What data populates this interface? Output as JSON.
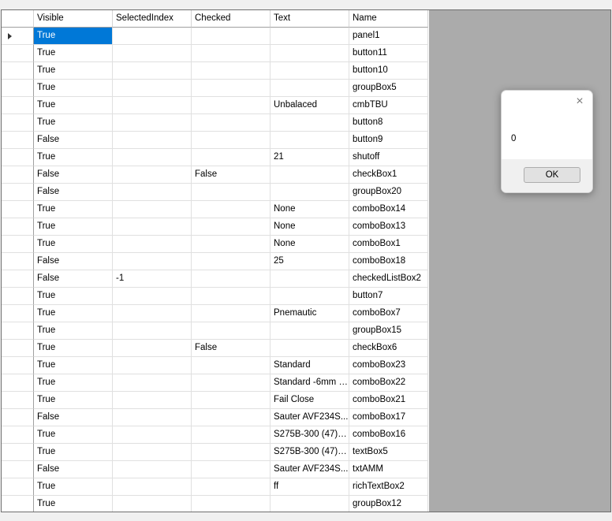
{
  "grid": {
    "columns": [
      "Visible",
      "SelectedIndex",
      "Checked",
      "Text",
      "Name"
    ],
    "rows": [
      [
        "True",
        "",
        "",
        "",
        "panel1"
      ],
      [
        "True",
        "",
        "",
        "",
        "button11"
      ],
      [
        "True",
        "",
        "",
        "",
        "button10"
      ],
      [
        "True",
        "",
        "",
        "",
        "groupBox5"
      ],
      [
        "True",
        "",
        "",
        "Unbalaced",
        "cmbTBU"
      ],
      [
        "True",
        "",
        "",
        "",
        "button8"
      ],
      [
        "False",
        "",
        "",
        "",
        "button9"
      ],
      [
        "True",
        "",
        "",
        "21",
        "shutoff"
      ],
      [
        "False",
        "",
        "False",
        "",
        "checkBox1"
      ],
      [
        "False",
        "",
        "",
        "",
        "groupBox20"
      ],
      [
        "True",
        "",
        "",
        "None",
        "comboBox14"
      ],
      [
        "True",
        "",
        "",
        "None",
        "comboBox13"
      ],
      [
        "True",
        "",
        "",
        "None",
        "comboBox1"
      ],
      [
        "False",
        "",
        "",
        "25",
        "comboBox18"
      ],
      [
        "False",
        "-1",
        "",
        "",
        "checkedListBox2"
      ],
      [
        "True",
        "",
        "",
        "",
        "button7"
      ],
      [
        "True",
        "",
        "",
        "Pnemautic",
        "comboBox7"
      ],
      [
        "True",
        "",
        "",
        "",
        "groupBox15"
      ],
      [
        "True",
        "",
        "False",
        "",
        "checkBox6"
      ],
      [
        "True",
        "",
        "",
        "Standard",
        "comboBox23"
      ],
      [
        "True",
        "",
        "",
        "Standard -6mm R...",
        "comboBox22"
      ],
      [
        "True",
        "",
        "",
        "Fail Close",
        "comboBox21"
      ],
      [
        "False",
        "",
        "",
        "Sauter AVF234S...",
        "comboBox17"
      ],
      [
        "True",
        "",
        "",
        "S275B-300 (47) 0...",
        "comboBox16"
      ],
      [
        "True",
        "",
        "",
        "S275B-300 (47) 0...",
        "textBox5"
      ],
      [
        "False",
        "",
        "",
        "Sauter AVF234S...",
        "txtAMM"
      ],
      [
        "True",
        "",
        "",
        "ff",
        "richTextBox2"
      ],
      [
        "True",
        "",
        "",
        "",
        "groupBox12"
      ]
    ],
    "selected_row": 0,
    "selected_col": 0,
    "current_row_icon": "row-pointer-icon"
  },
  "message_box": {
    "message": "0",
    "ok_label": "OK",
    "close_glyph": "×",
    "close_icon": "close-icon"
  },
  "colors": {
    "selection": "#0078d7",
    "workspace": "#ababab"
  }
}
